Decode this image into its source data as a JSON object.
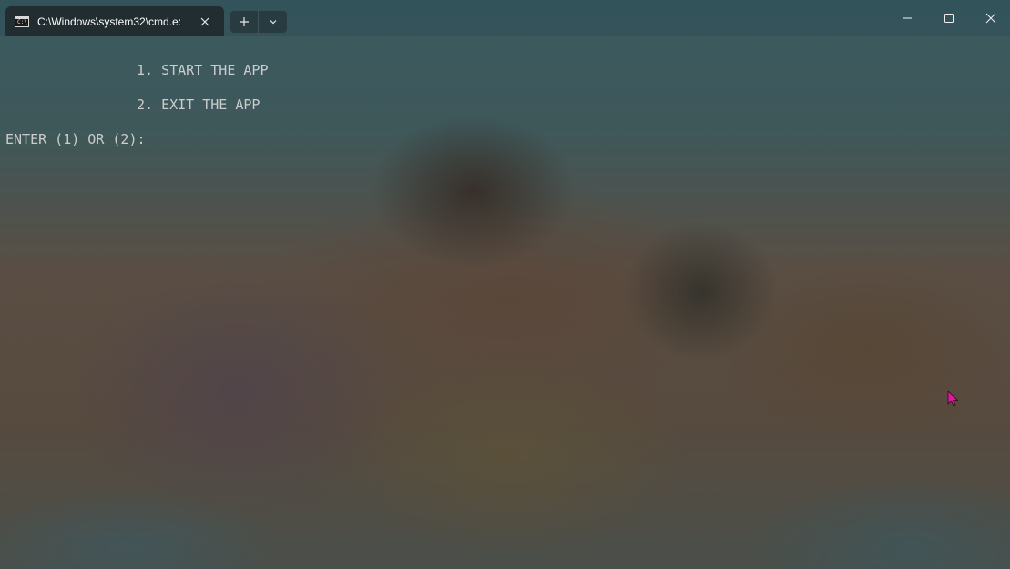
{
  "window": {
    "tab_title": "C:\\Windows\\system32\\cmd.e:",
    "tab_icon": "cmd-icon",
    "tab_icon_text": "C:\\",
    "new_tab_icon": "plus-icon",
    "dropdown_icon": "chevron-down-icon",
    "controls": {
      "minimize_icon": "minimize-icon",
      "maximize_icon": "maximize-icon",
      "close_icon": "close-icon"
    }
  },
  "terminal": {
    "lines": [
      "1. START THE APP",
      "2. EXIT THE APP",
      "ENTER (1) OR (2):"
    ],
    "text_color": "#cccccc"
  },
  "colors": {
    "cursor": "#e0189a",
    "tab_background": "#202a2e"
  }
}
